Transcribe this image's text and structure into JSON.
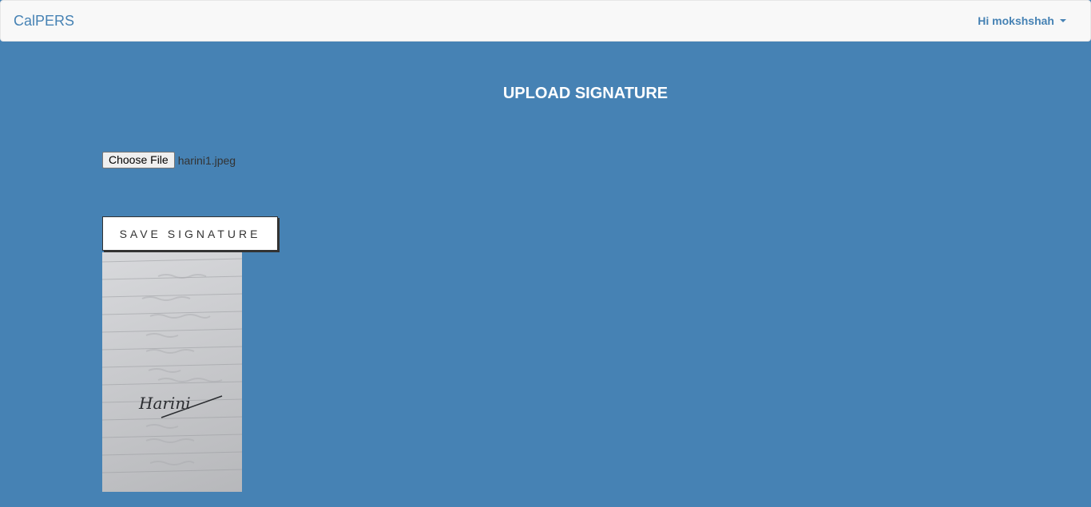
{
  "navbar": {
    "brand": "CalPERS",
    "user_menu_label": "Hi mokshshah"
  },
  "main": {
    "title": "UPLOAD SIGNATURE",
    "file_input": {
      "button_label": "Choose File",
      "selected_file": "harini1.jpeg"
    },
    "save_button_label": "SAVE SIGNATURE",
    "signature_image": {
      "signature_text": "Harini"
    }
  },
  "colors": {
    "page_background": "#4682b4",
    "navbar_background": "#f8f8f8",
    "brand_text": "#4682b4"
  }
}
